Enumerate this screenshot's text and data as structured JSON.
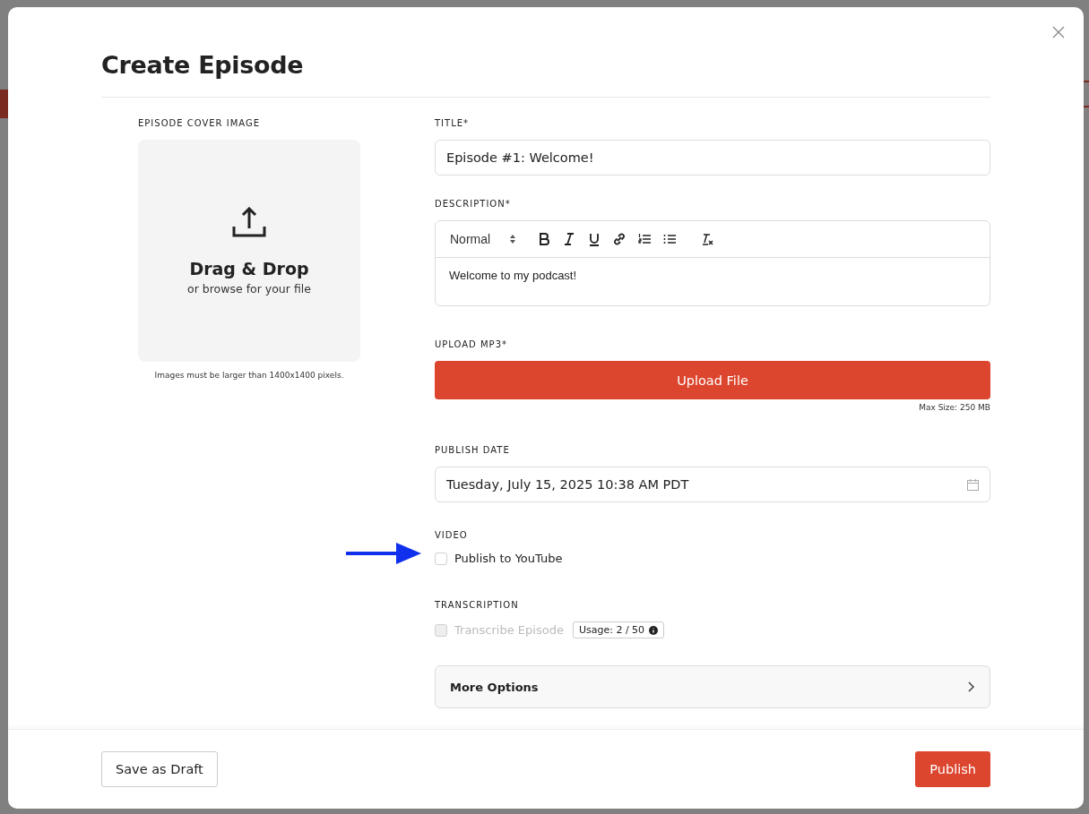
{
  "dialog": {
    "title": "Create Episode"
  },
  "cover": {
    "label": "EPISODE COVER IMAGE",
    "heading": "Drag & Drop",
    "subtext": "or browse for your file",
    "note": "Images must be larger than 1400x1400 pixels."
  },
  "title_field": {
    "label": "TITLE*",
    "value": "Episode #1: Welcome!"
  },
  "description": {
    "label": "DESCRIPTION*",
    "format": "Normal",
    "value": "Welcome to my podcast!"
  },
  "upload": {
    "label": "UPLOAD MP3*",
    "button": "Upload File",
    "note": "Max Size: 250 MB"
  },
  "publish_date": {
    "label": "PUBLISH DATE",
    "value": "Tuesday, July 15, 2025 10:38 AM PDT"
  },
  "video": {
    "label": "VIDEO",
    "option": {
      "label": "Publish to YouTube",
      "checked": false,
      "disabled": false
    }
  },
  "transcription": {
    "label": "TRANSCRIPTION",
    "option": {
      "label": "Transcribe Episode",
      "checked": false,
      "disabled": true
    },
    "usage": "Usage: 2 / 50"
  },
  "more_options": {
    "label": "More Options",
    "expanded": false
  },
  "footer": {
    "draft": "Save as Draft",
    "publish": "Publish"
  }
}
